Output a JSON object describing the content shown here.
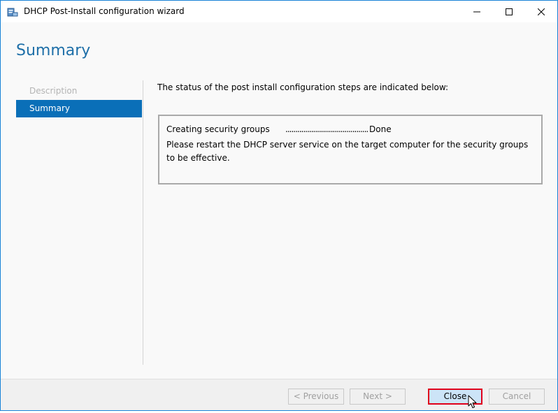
{
  "window": {
    "title": "DHCP Post-Install configuration wizard",
    "icon": "dhcp-server-icon",
    "controls": [
      "minimize-icon",
      "maximize-icon",
      "close-icon"
    ]
  },
  "page": {
    "title": "Summary"
  },
  "nav": {
    "items": [
      {
        "label": "Description",
        "state": "disabled"
      },
      {
        "label": "Summary",
        "state": "active"
      }
    ]
  },
  "main": {
    "intro": "The status of the post install configuration steps are indicated below:",
    "steps": [
      {
        "name": "Creating security groups",
        "dots": "..........................................",
        "status": "Done"
      }
    ],
    "note": "Please restart the DHCP server service on the target computer for the security groups to be effective."
  },
  "footer": {
    "previous_label": "< Previous",
    "next_label": "Next >",
    "close_label": "Close",
    "cancel_label": "Cancel"
  },
  "colors": {
    "accent": "#0a6fb8",
    "title": "#1e6fa8",
    "highlight_border": "#e0001b"
  }
}
